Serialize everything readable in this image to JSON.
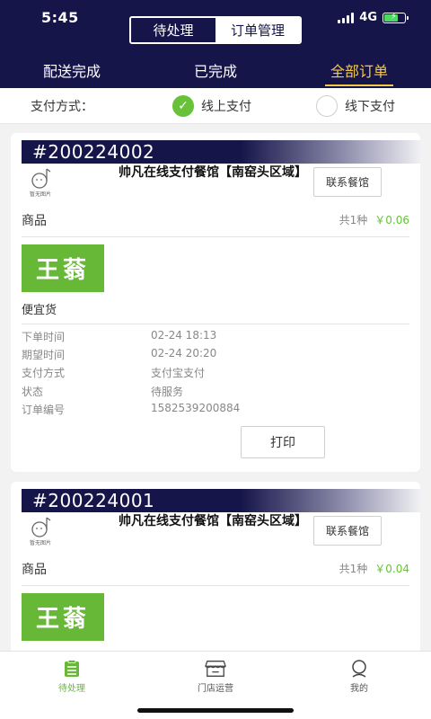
{
  "status": {
    "time": "5:45",
    "network": "4G"
  },
  "segment": {
    "left": "待处理",
    "right": "订单管理"
  },
  "tabs": [
    {
      "label": "配送完成",
      "active": false
    },
    {
      "label": "已完成",
      "active": false
    },
    {
      "label": "全部订单",
      "active": true
    }
  ],
  "pay_filter": {
    "label": "支付方式：",
    "options": [
      {
        "label": "线上支付",
        "checked": true
      },
      {
        "label": "线下支付",
        "checked": false
      }
    ]
  },
  "orders": [
    {
      "number": "#200224002",
      "logo_text": "暂无图片",
      "shop_name": "帅凡在线支付餐馆【南窑头区域】",
      "contact_label": "联系餐馆",
      "goods_label": "商品",
      "goods_count": "共1种",
      "goods_total": "￥0.06",
      "goods_thumb_text": "王蓊",
      "goods_name": "便宜货",
      "info": [
        {
          "key": "下单时间",
          "value": "02-24 18:13"
        },
        {
          "key": "期望时间",
          "value": "02-24 20:20"
        },
        {
          "key": "支付方式",
          "value": "支付宝支付"
        },
        {
          "key": "状态",
          "value": "待服务"
        },
        {
          "key": "订单编号",
          "value": "1582539200884"
        }
      ],
      "print_label": "打印"
    },
    {
      "number": "#200224001",
      "logo_text": "暂无图片",
      "shop_name": "帅凡在线支付餐馆【南窑头区域】",
      "contact_label": "联系餐馆",
      "goods_label": "商品",
      "goods_count": "共1种",
      "goods_total": "￥0.04",
      "goods_thumb_text": "王蓊"
    }
  ],
  "bottom_nav": [
    {
      "label": "待处理",
      "icon": "clipboard-icon",
      "active": true
    },
    {
      "label": "门店运营",
      "icon": "store-icon",
      "active": false
    },
    {
      "label": "我的",
      "icon": "user-icon",
      "active": false
    }
  ],
  "colors": {
    "header": "#16154a",
    "accent_yellow": "#f5c945",
    "green": "#67c23a"
  }
}
